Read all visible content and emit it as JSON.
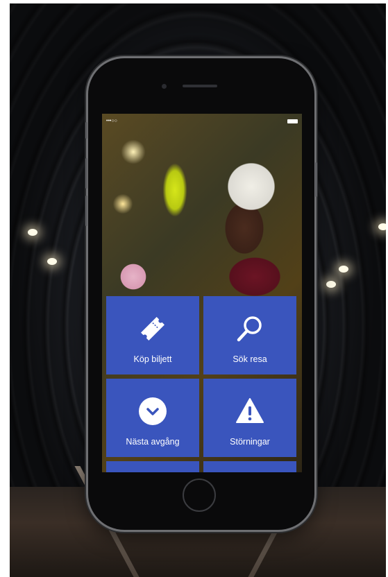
{
  "status_bar": {
    "signal": "•••○○"
  },
  "tiles": [
    {
      "label": "Köp biljett",
      "icon": "ticket-icon"
    },
    {
      "label": "Sök resa",
      "icon": "search-icon"
    },
    {
      "label": "Nästa avgång",
      "icon": "clock-chevron-icon"
    },
    {
      "label": "Störningar",
      "icon": "warning-icon"
    }
  ],
  "colors": {
    "tile": "#3a55bd",
    "label": "#ffffff"
  }
}
